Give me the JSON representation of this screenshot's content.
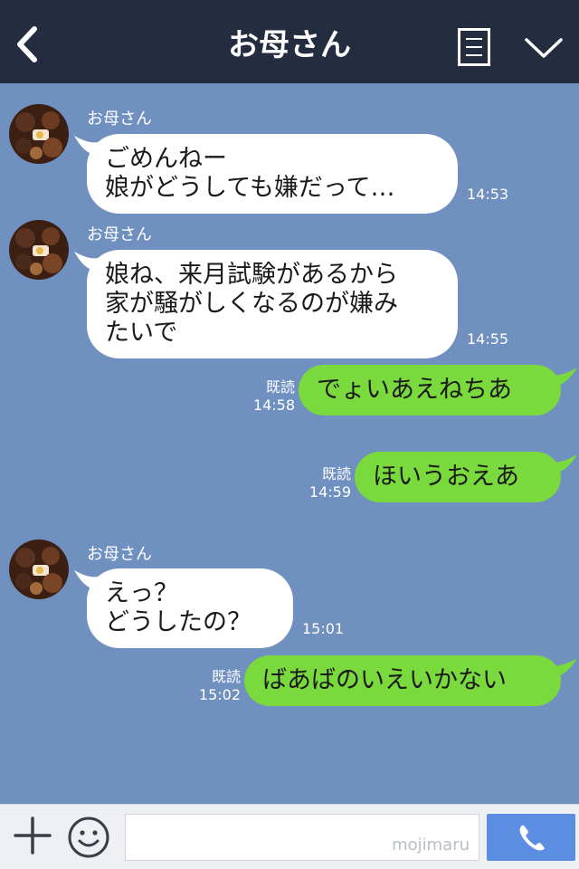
{
  "header": {
    "title": "お母さん"
  },
  "messages": [
    {
      "sender": "お母さん",
      "lines": [
        "ごめんねー",
        "娘がどうしても嫌だって…"
      ],
      "time": "14:53"
    },
    {
      "sender": "お母さん",
      "lines": [
        "娘ね、来月試験があるから",
        "家が騒がしくなるのが嫌み",
        "たいで"
      ],
      "time": "14:55"
    },
    {
      "text": "でょいあえねちあ",
      "read": "既読",
      "time": "14:58"
    },
    {
      "text": "ほいうおえあ",
      "read": "既読",
      "time": "14:59"
    },
    {
      "sender": "お母さん",
      "lines": [
        "えっ？",
        "どうしたの？"
      ],
      "time": "15:01"
    },
    {
      "text": "ばあばのいえいかない",
      "read": "既読",
      "time": "15:02"
    }
  ],
  "footer": {
    "watermark": "mojimaru"
  },
  "icons": {
    "back": "chevron-left-icon",
    "menu": "menu-icon",
    "expand": "chevron-down-icon",
    "plus": "plus-icon",
    "emoji": "smiley-icon",
    "call": "phone-icon"
  },
  "colors": {
    "header_bg": "#242c40",
    "chat_bg": "#7090c0",
    "incoming_bubble": "#ffffff",
    "outgoing_bubble": "#7ad93c",
    "call_button": "#5b8ee0"
  }
}
